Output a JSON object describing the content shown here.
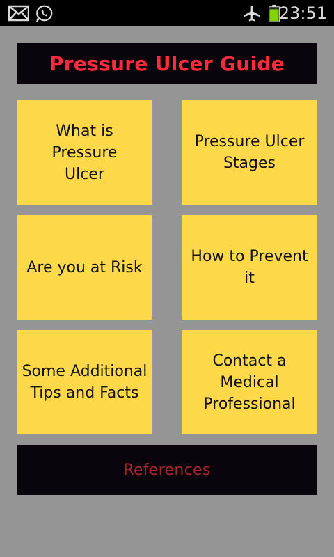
{
  "status_bar": {
    "icons": [
      "mail-icon",
      "whatsapp-icon",
      "airplane-mode-icon",
      "battery-icon"
    ],
    "time": "23:51",
    "battery_color": "#7fd400"
  },
  "header": {
    "title": "Pressure Ulcer Guide",
    "title_color": "#ff2b3a"
  },
  "tiles": [
    {
      "label": "What is\nPressure\nUlcer"
    },
    {
      "label": "Pressure Ulcer\nStages"
    },
    {
      "label": "Are you at Risk"
    },
    {
      "label": "How to Prevent\nit"
    },
    {
      "label": "Some Additional\nTips and Facts"
    },
    {
      "label": "Contact a\nMedical\nProfessional"
    }
  ],
  "references": {
    "label": "References",
    "color": "#a8232b"
  },
  "colors": {
    "background": "#959595",
    "tile": "#fdd94a",
    "tile_text": "#111111",
    "banner": "#0a050c"
  }
}
